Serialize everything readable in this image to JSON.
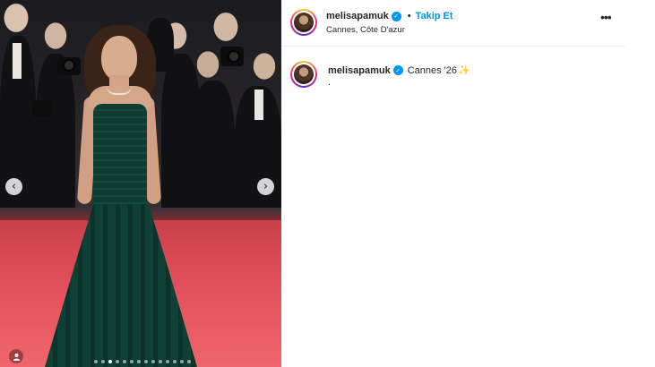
{
  "post": {
    "carousel": {
      "slide_count": 14,
      "active_slide": 3,
      "prev_icon": "‹",
      "next_icon": "›",
      "tag_icon": "person-icon"
    }
  },
  "header": {
    "username": "melisapamuk",
    "verified_icon": "✓",
    "separator": "•",
    "follow_label": "Takip Et",
    "location": "Cannes, Côte D'azur",
    "more_icon": "•••"
  },
  "caption": {
    "username": "melisapamuk",
    "verified_icon": "✓",
    "text": "Cannes '26",
    "emoji": "✨",
    "second_line": "."
  },
  "colors": {
    "accent": "#0095f6",
    "text": "#262626",
    "divider": "#efefef"
  }
}
